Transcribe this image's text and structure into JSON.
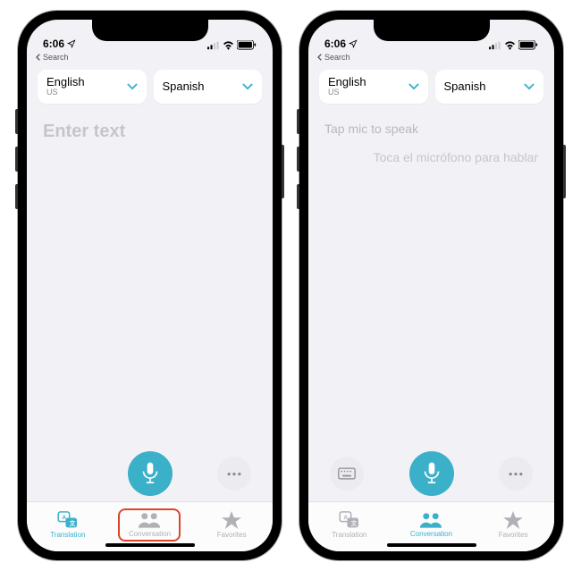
{
  "status": {
    "time": "6:06",
    "back_label": "Search"
  },
  "languages": {
    "source": {
      "name": "English",
      "sub": "US"
    },
    "target": {
      "name": "Spanish",
      "sub": ""
    }
  },
  "left": {
    "placeholder": "Enter text"
  },
  "right": {
    "prompt_primary": "Tap mic to speak",
    "prompt_secondary": "Toca el micrófono para hablar"
  },
  "tabs": {
    "translation": "Translation",
    "conversation": "Conversation",
    "favorites": "Favorites"
  },
  "colors": {
    "accent": "#3bb0c9",
    "highlight": "#d9472b"
  }
}
